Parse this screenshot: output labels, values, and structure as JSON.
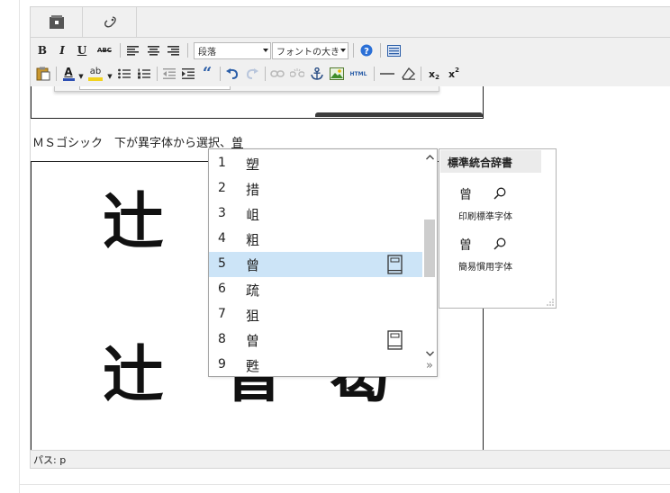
{
  "tabs": [
    {
      "name": "tab-home-icon",
      "icon": "home-icon"
    },
    {
      "name": "tab-link-icon",
      "icon": "link-icon"
    }
  ],
  "toolbar": {
    "bold": "B",
    "italic": "I",
    "underline": "U",
    "strikethrough": "ABC",
    "format_select": "段落",
    "font_size_select": "フォントの大き",
    "font_color": "A",
    "highlight": "ab",
    "quote": "“",
    "html_label": "HTML",
    "subscript": "x",
    "subscript_mark": "2",
    "superscript": "x",
    "superscript_mark": "2"
  },
  "editor": {
    "line_text": "ＭＳゴシック　下が異字体から選択、",
    "composing_char": "曽",
    "big_row1": [
      "辻"
    ],
    "big_row2": [
      "辻",
      "曽",
      "曷"
    ]
  },
  "candidates": {
    "items": [
      {
        "num": "1",
        "char": "塑",
        "book": false
      },
      {
        "num": "2",
        "char": "措",
        "book": false
      },
      {
        "num": "3",
        "char": "岨",
        "book": false
      },
      {
        "num": "4",
        "char": "粗",
        "book": false
      },
      {
        "num": "5",
        "char": "曾",
        "book": true,
        "selected": true
      },
      {
        "num": "6",
        "char": "疏",
        "book": false
      },
      {
        "num": "7",
        "char": "狙",
        "book": false
      },
      {
        "num": "8",
        "char": "曽",
        "book": true
      },
      {
        "num": "9",
        "char": "甦",
        "book": false
      }
    ],
    "expand_glyph": "»"
  },
  "dictionary": {
    "title": "標準統合辞書",
    "entries": [
      {
        "char": "曾",
        "label": "印刷標準字体"
      },
      {
        "char": "曽",
        "label": "簡易慣用字体"
      }
    ]
  },
  "status_bar": {
    "path": "パス: p"
  },
  "colors": {
    "selected_row": "#cce4f7",
    "chrome": "#f0f0f0",
    "border": "#d4d4d4",
    "accent": "#1a5fb4"
  }
}
